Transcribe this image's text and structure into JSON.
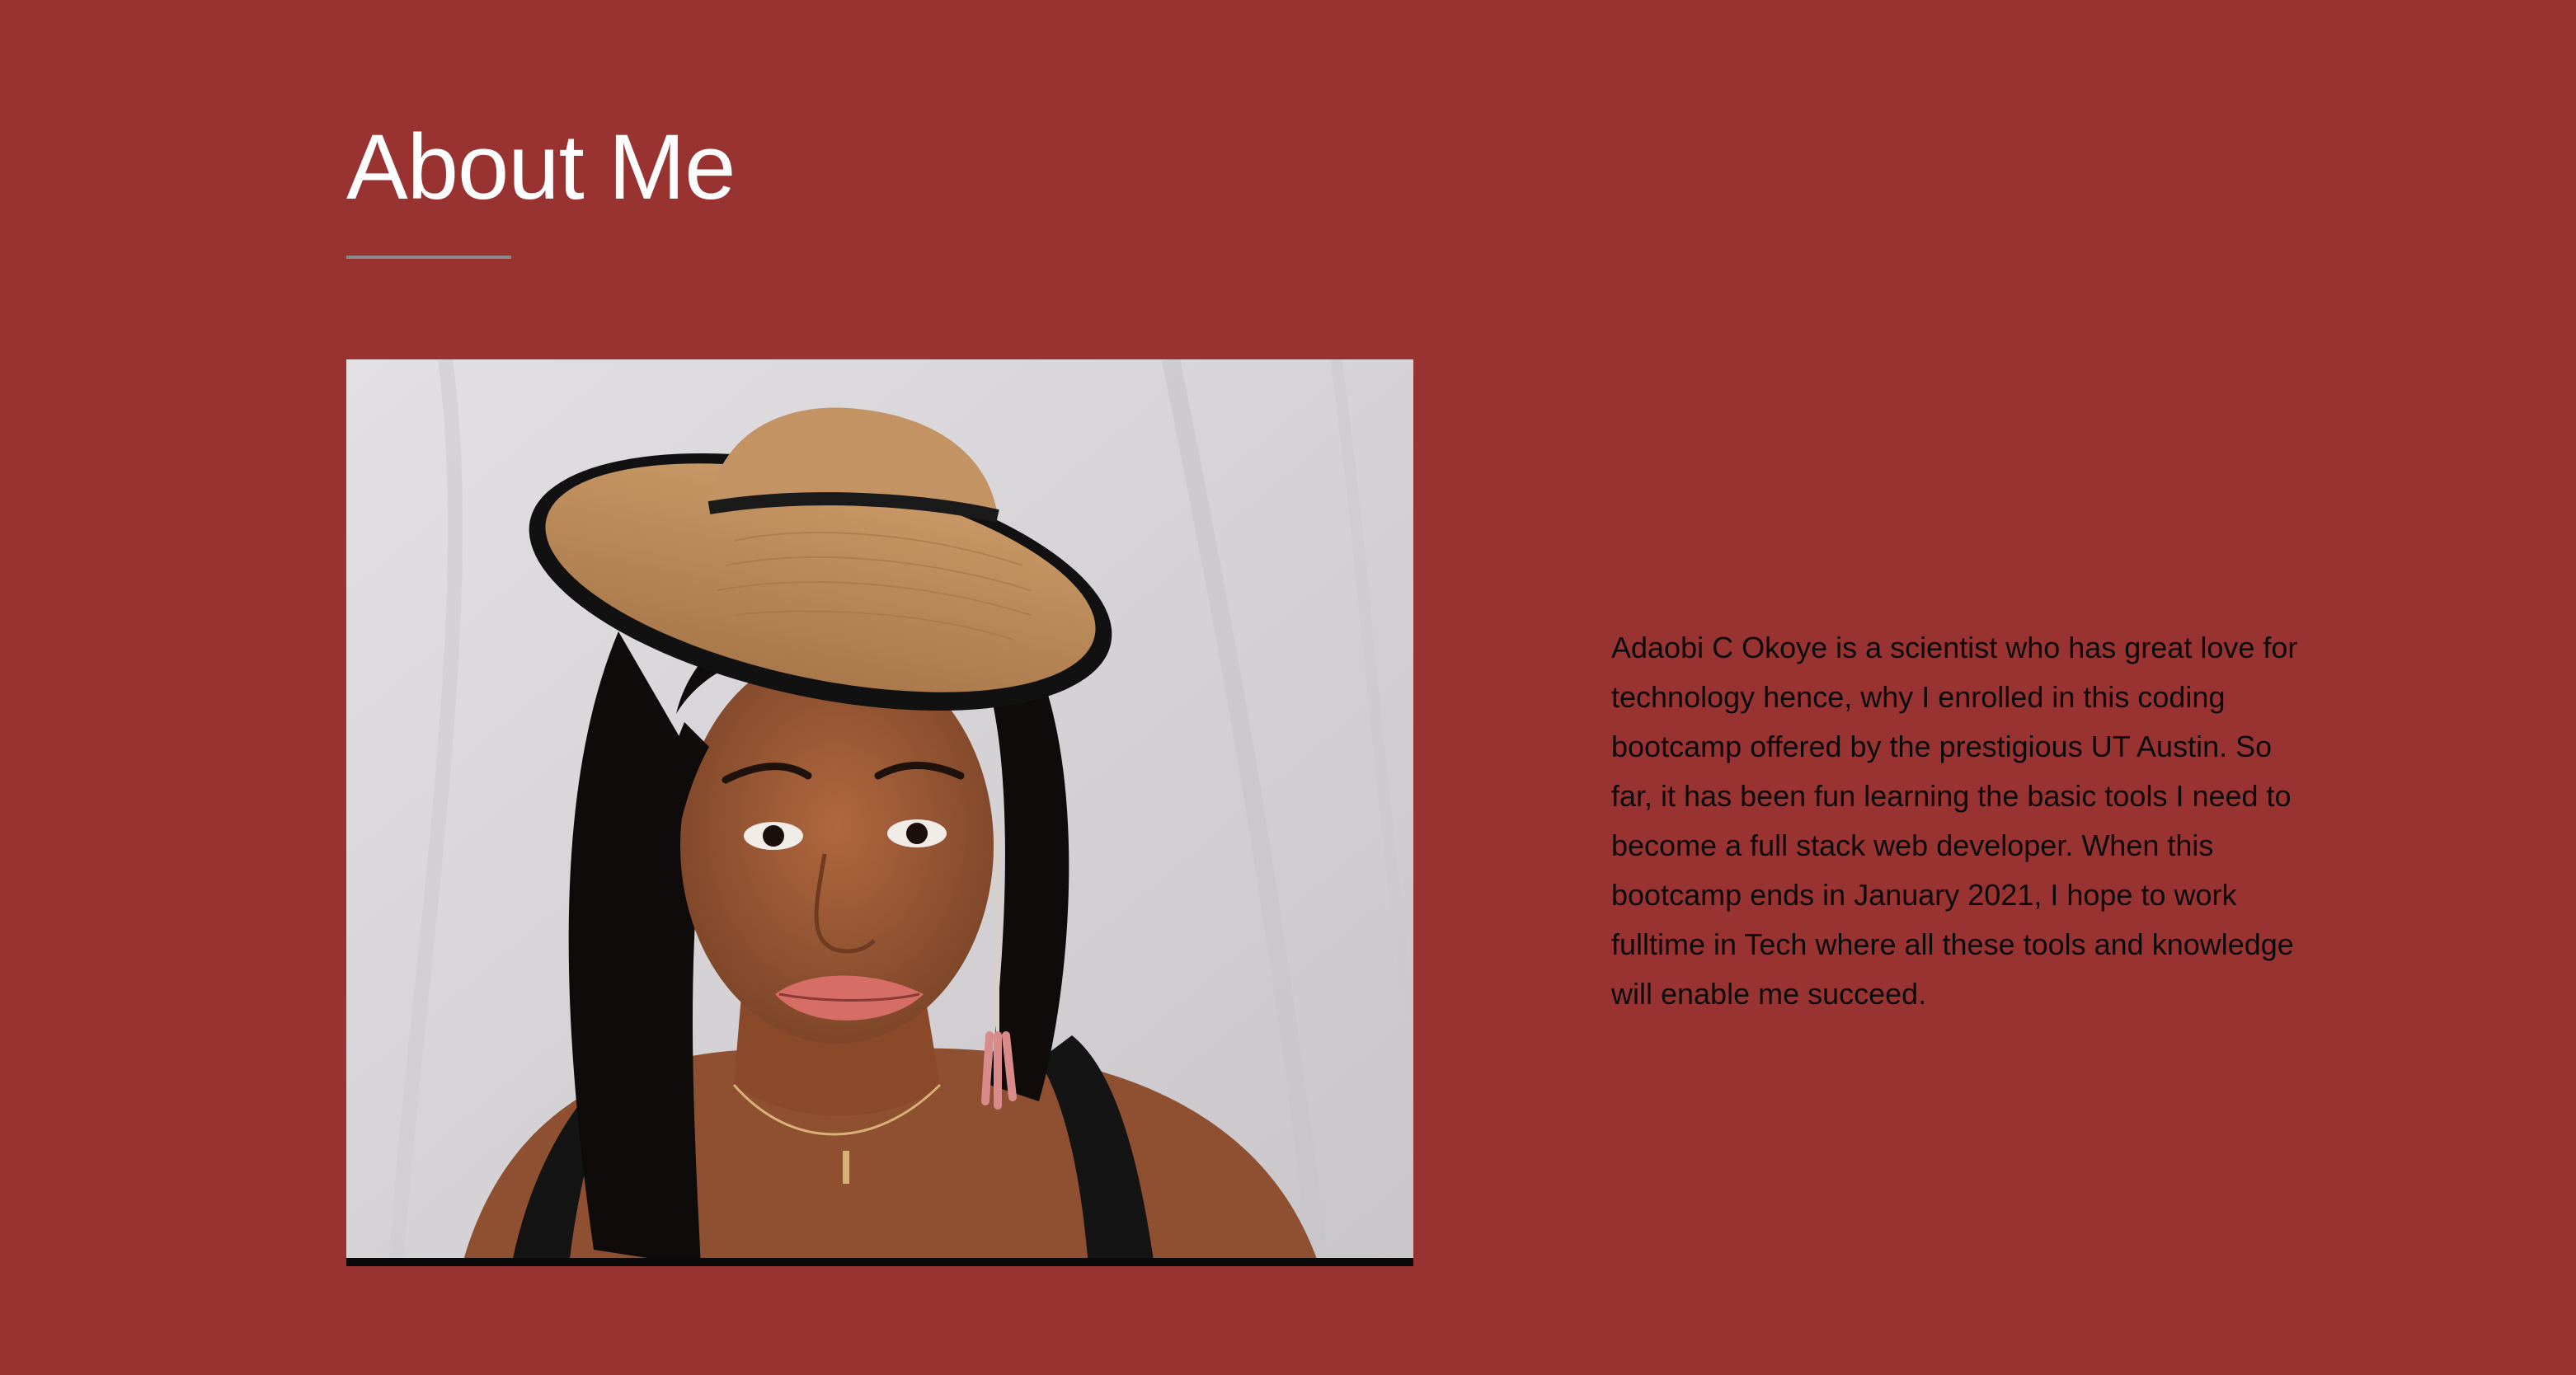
{
  "about": {
    "title": "About Me",
    "bio": "Adaobi C Okoye is a scientist who has great love for technology hence, why I enrolled in this coding bootcamp offered by the prestigious UT Austin. So far, it has been fun learning the basic tools I need to become a full stack web developer. When this bootcamp ends in January 2021, I hope to work fulltime in Tech where all these tools and knowledge will enable me succeed."
  },
  "colors": {
    "background": "#983331",
    "title": "#ffffff",
    "divider": "#8a8a8a",
    "bio_text": "#0b0b0b"
  }
}
